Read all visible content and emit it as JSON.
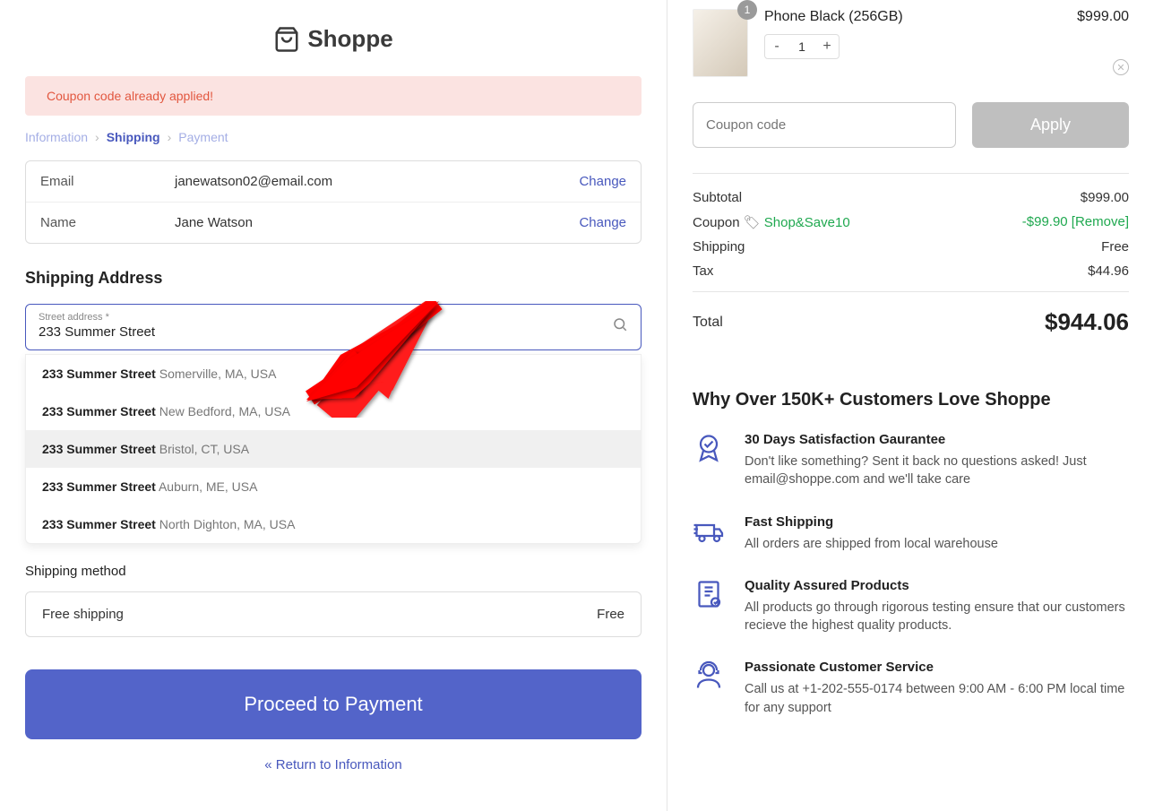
{
  "brand": "Shoppe",
  "alert": "Coupon code already applied!",
  "breadcrumb": {
    "info": "Information",
    "shipping": "Shipping",
    "payment": "Payment"
  },
  "info": {
    "email_label": "Email",
    "email_value": "janewatson02@email.com",
    "name_label": "Name",
    "name_value": "Jane Watson",
    "change": "Change"
  },
  "shipping_title": "Shipping Address",
  "address": {
    "floating_label": "Street address *",
    "value": "233 Summer Street",
    "suggestions": [
      {
        "main": "233 Summer Street",
        "sub": "Somerville, MA, USA"
      },
      {
        "main": "233 Summer Street",
        "sub": "New Bedford, MA, USA"
      },
      {
        "main": "233 Summer Street",
        "sub": "Bristol, CT, USA"
      },
      {
        "main": "233 Summer Street",
        "sub": "Auburn, ME, USA"
      },
      {
        "main": "233 Summer Street",
        "sub": "North Dighton, MA, USA"
      }
    ]
  },
  "shipping_method": {
    "label": "Shipping method",
    "option": "Free shipping",
    "price": "Free"
  },
  "proceed": "Proceed to Payment",
  "return": "« Return to Information",
  "cart": {
    "item": {
      "name": "Phone Black (256GB)",
      "price": "$999.00",
      "qty": "1",
      "badge": "1"
    },
    "coupon_placeholder": "Coupon code",
    "apply": "Apply"
  },
  "summary": {
    "subtotal_label": "Subtotal",
    "subtotal": "$999.00",
    "coupon_label": "Coupon",
    "coupon_code": "Shop&Save10",
    "coupon_val": "-$99.90 [Remove]",
    "shipping_label": "Shipping",
    "shipping_val": "Free",
    "tax_label": "Tax",
    "tax_val": "$44.96",
    "total_label": "Total",
    "total_val": "$944.06"
  },
  "benefits": {
    "title": "Why Over 150K+ Customers Love Shoppe",
    "items": [
      {
        "title": "30 Days Satisfaction Gaurantee",
        "text": "Don't like something? Sent it back no questions asked! Just email@shoppe.com and we'll take care"
      },
      {
        "title": "Fast Shipping",
        "text": "All orders are shipped from local warehouse"
      },
      {
        "title": "Quality Assured Products",
        "text": "All products go through rigorous testing ensure that our customers recieve the highest quality products."
      },
      {
        "title": "Passionate Customer Service",
        "text": "Call us at +1-202-555-0174 between 9:00 AM - 6:00 PM local time for any support"
      }
    ]
  }
}
